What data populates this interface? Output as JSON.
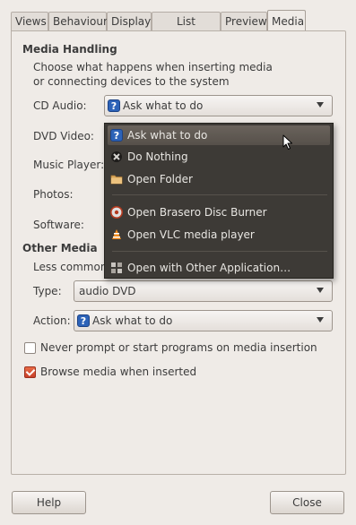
{
  "tabs": [
    {
      "label": "Views"
    },
    {
      "label": "Behaviour"
    },
    {
      "label": "Display"
    },
    {
      "label": "List Columns"
    },
    {
      "label": "Preview"
    },
    {
      "label": "Media"
    }
  ],
  "media_handling": {
    "title": "Media Handling",
    "description_line1": "Choose what happens when inserting media",
    "description_line2": "or connecting devices to the system",
    "cd_audio": {
      "label": "CD Audio:",
      "value": "Ask what to do"
    },
    "dvd_video": {
      "label": "DVD Video:"
    },
    "music_player": {
      "label": "Music Player:"
    },
    "photos": {
      "label": "Photos:"
    },
    "software": {
      "label": "Software:"
    }
  },
  "dropdown": {
    "items": [
      {
        "label": "Ask what to do",
        "icon": "question-icon"
      },
      {
        "label": "Do Nothing",
        "icon": "do-nothing-icon"
      },
      {
        "label": "Open Folder",
        "icon": "folder-icon"
      },
      {
        "label": "Open Brasero Disc Burner",
        "icon": "brasero-icon"
      },
      {
        "label": "Open VLC media player",
        "icon": "vlc-icon"
      },
      {
        "label": "Open with Other Application…",
        "icon": "application-icon"
      }
    ]
  },
  "other_media": {
    "title": "Other Media",
    "description": "Less common m",
    "type": {
      "label": "Type:",
      "value": "audio DVD"
    },
    "action": {
      "label": "Action:",
      "value": "Ask what to do"
    }
  },
  "checkboxes": {
    "never_prompt": {
      "label": "Never prompt or start programs on media insertion",
      "checked": false
    },
    "browse_media": {
      "label": "Browse media when inserted",
      "checked": true
    }
  },
  "buttons": {
    "help": "Help",
    "close": "Close"
  },
  "colors": {
    "window_bg": "#efebe7",
    "menu_bg": "#3d3a36",
    "checkbox_on": "#d9533a",
    "question_icon": "#2d63b8"
  }
}
